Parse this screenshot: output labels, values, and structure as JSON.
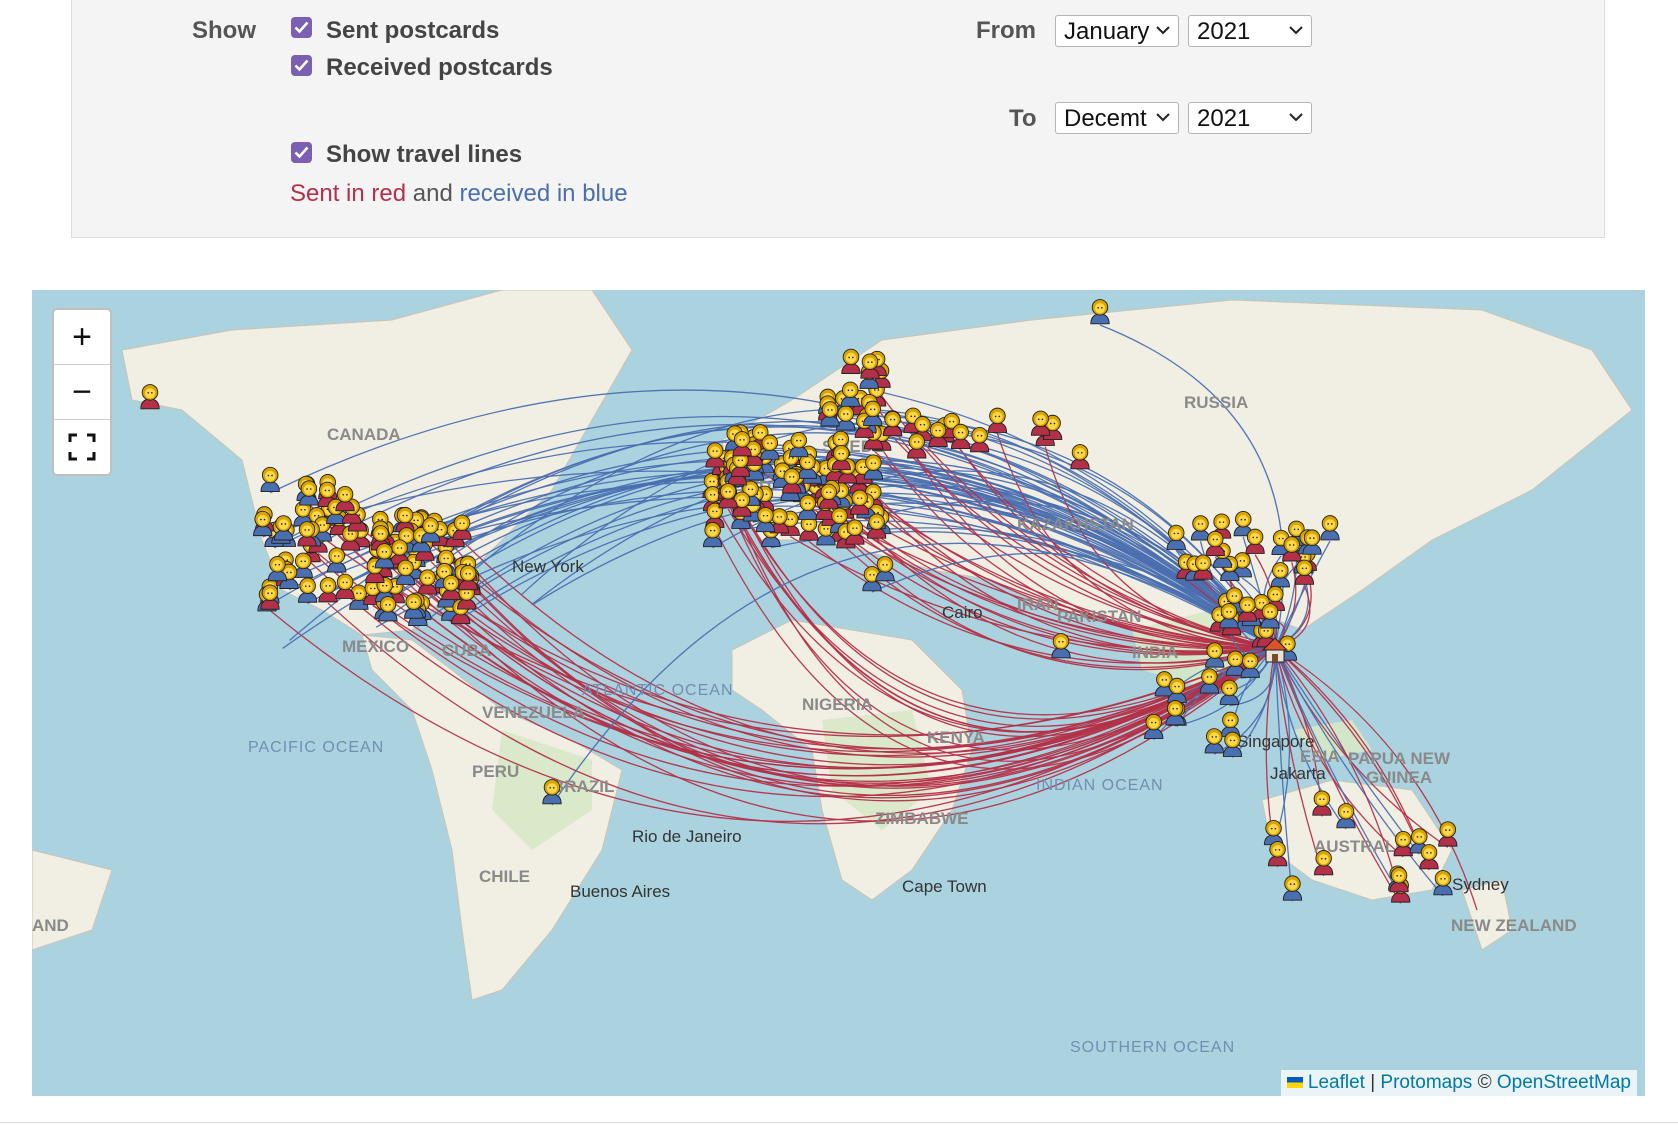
{
  "filters": {
    "show_label": "Show",
    "checkboxes": [
      {
        "label": "Sent postcards",
        "checked": true
      },
      {
        "label": "Received postcards",
        "checked": true
      },
      {
        "label": "Show travel lines",
        "checked": true
      }
    ],
    "from_label": "From",
    "to_label": "To",
    "from_month": "January",
    "from_year": "2021",
    "to_month": "Decemt",
    "to_year": "2021",
    "legend": {
      "sent": "Sent in red",
      "and": "and",
      "received": "received in blue"
    },
    "checkbox_color": "#7a5fb3"
  },
  "map": {
    "controls": {
      "zoom_in": "+",
      "zoom_out": "−"
    },
    "labels": {
      "canada": "CANADA",
      "russia": "RUSSIA",
      "sweden": "SWEDE",
      "united": "UNITED",
      "kazakhstan": "KAZAKHSTAN",
      "iran": "IRAN",
      "pakistan": "PAKISTAN",
      "india": "INDIA",
      "new_york": "New York",
      "mexico": "MEXICO",
      "cuba": "CUBA",
      "atlantic": "ATLANTIC OCEAN",
      "pacific": "PACIFIC OCEAN",
      "venezuela": "VENEZUELA",
      "peru": "PERU",
      "brazil": "BRAZIL",
      "chile": "CHILE",
      "buenos_aires": "Buenos Aires",
      "rio": "Rio de Janeiro",
      "nigeria": "NIGERIA",
      "kenya": "KENYA",
      "zimbabwe": "ZIMBABWE",
      "cape_town": "Cape Town",
      "indian_ocean": "INDIAN OCEAN",
      "singapore": "Singapore",
      "jakarta": "Jakarta",
      "indonesia": "ESIA",
      "papua": "PAPUA NEW",
      "guinea": "GUINEA",
      "australia": "AUSTRALIA",
      "sydney": "Sydney",
      "new_zealand": "NEW ZEALAND",
      "southern_ocean": "SOUTHERN OCEAN",
      "and_left": "AND",
      "cairo": "Cairo"
    },
    "colors": {
      "sent": "#b43048",
      "received": "#4a6fb0",
      "water": "#aad3df",
      "land": "#f2efe3",
      "green": "#cfe5c0"
    },
    "attribution": {
      "leaflet": "Leaflet",
      "sep": "|",
      "protomaps": "Protomaps",
      "copy": "©",
      "osm": "OpenStreetMap"
    }
  }
}
